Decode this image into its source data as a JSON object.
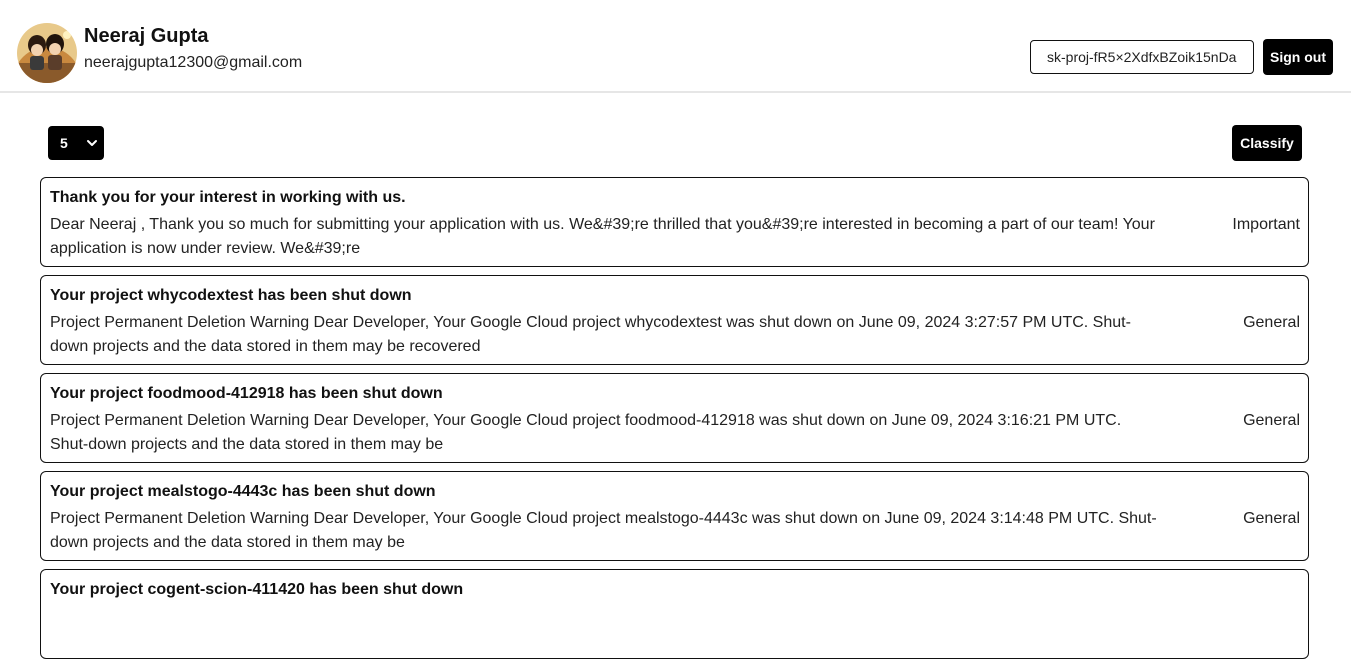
{
  "user": {
    "name": "Neeraj Gupta",
    "email": "neerajgupta12300@gmail.com"
  },
  "header": {
    "api_key_value": "sk-proj-fR5×2XdfxBZoik15nDa",
    "signout_label": "Sign out"
  },
  "toolbar": {
    "count_selected": "5",
    "classify_label": "Classify"
  },
  "emails": [
    {
      "subject": "Thank you for your interest in working with us.",
      "snippet": "Dear Neeraj , Thank you so much for submitting your application with us. We&#39;re thrilled that you&#39;re interested in becoming a part of our team! Your application is now under review. We&#39;re",
      "label": "Important"
    },
    {
      "subject": "Your project whycodextest has been shut down",
      "snippet": "Project Permanent Deletion Warning Dear Developer, Your Google Cloud project whycodextest was shut down on June 09, 2024 3:27:57 PM UTC. Shut-down projects and the data stored in them may be recovered",
      "label": "General"
    },
    {
      "subject": "Your project foodmood-412918 has been shut down",
      "snippet": "Project Permanent Deletion Warning Dear Developer, Your Google Cloud project foodmood-412918 was shut down on June 09, 2024 3:16:21 PM UTC. Shut-down projects and the data stored in them may be",
      "label": "General"
    },
    {
      "subject": "Your project mealstogo-4443c has been shut down",
      "snippet": "Project Permanent Deletion Warning Dear Developer, Your Google Cloud project mealstogo-4443c was shut down on June 09, 2024 3:14:48 PM UTC. Shut-down projects and the data stored in them may be",
      "label": "General"
    },
    {
      "subject": "Your project cogent-scion-411420 has been shut down",
      "snippet": "",
      "label": ""
    }
  ]
}
